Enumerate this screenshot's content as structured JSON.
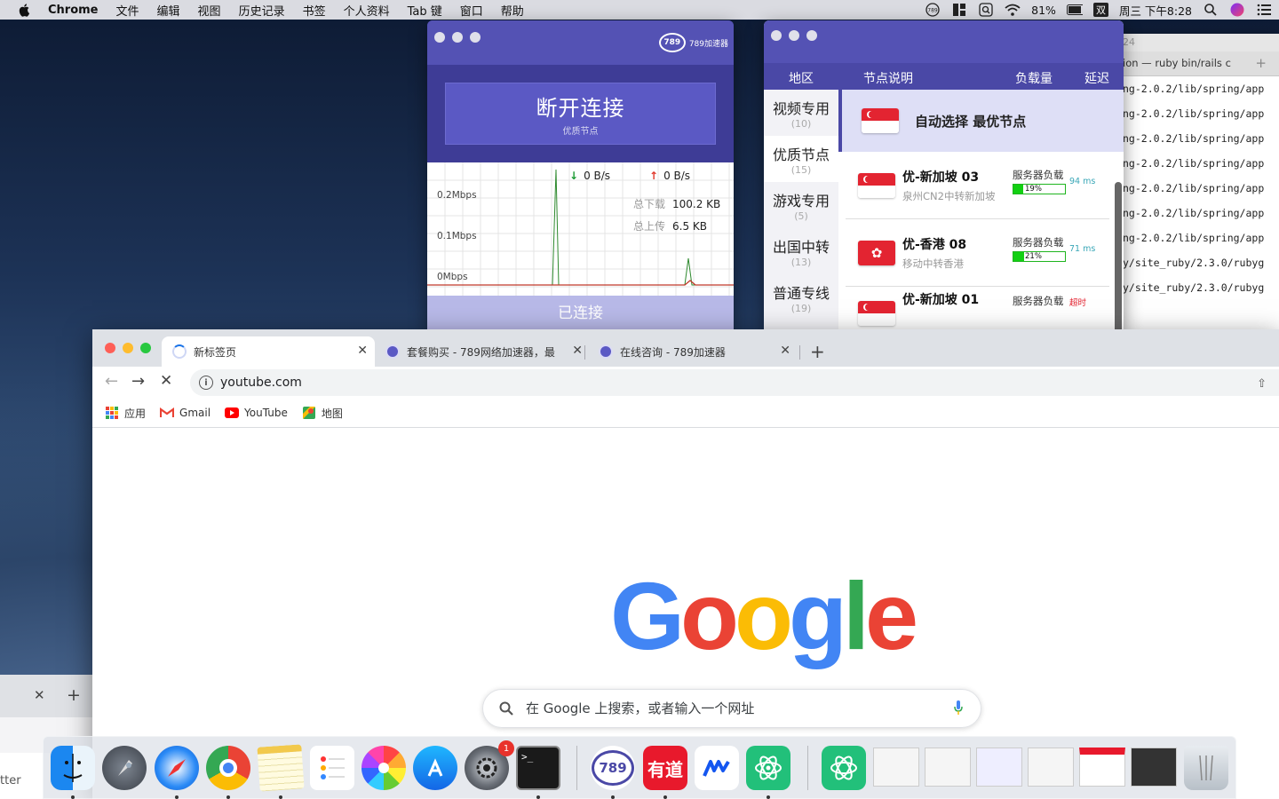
{
  "menubar": {
    "app_name": "Chrome",
    "items": [
      "文件",
      "编辑",
      "视图",
      "历史记录",
      "书签",
      "个人资料",
      "Tab 键",
      "窗口",
      "帮助"
    ],
    "battery": "81%",
    "input_method": "双",
    "clock": "周三 下午8:28"
  },
  "terminal": {
    "title_fragment": "24",
    "tab_title": "ion — ruby bin/rails c",
    "lines": [
      "ng-2.0.2/lib/spring/app",
      "ng-2.0.2/lib/spring/app",
      "ng-2.0.2/lib/spring/app",
      "ng-2.0.2/lib/spring/app",
      "ng-2.0.2/lib/spring/app",
      "ng-2.0.2/lib/spring/app",
      "ng-2.0.2/lib/spring/app",
      "y/site_ruby/2.3.0/rubyg",
      "y/site_ruby/2.3.0/rubyg"
    ]
  },
  "accel_main": {
    "brand_logo": "789",
    "brand_name": "789加速器",
    "disconnect_label": "断开连接",
    "disconnect_sub": "优质节点",
    "download_speed": "0 B/s",
    "upload_speed": "0 B/s",
    "axis": [
      "0.2Mbps",
      "0.1Mbps",
      "0Mbps"
    ],
    "total_download_label": "总下载",
    "total_download": "100.2 KB",
    "total_upload_label": "总上传",
    "total_upload": "6.5 KB",
    "status": "已连接"
  },
  "accel_nodes": {
    "header": {
      "region": "地区",
      "desc": "节点说明",
      "load": "负载量",
      "latency": "延迟"
    },
    "categories": [
      {
        "name": "视频专用",
        "count": "(10)"
      },
      {
        "name": "优质节点",
        "count": "(15)"
      },
      {
        "name": "游戏专用",
        "count": "(5)"
      },
      {
        "name": "出国中转",
        "count": "(13)"
      },
      {
        "name": "普通专线",
        "count": "(19)"
      }
    ],
    "auto_label": "自动选择 最优节点",
    "nodes": [
      {
        "name": "优-新加坡 03",
        "desc": "泉州CN2中转新加坡",
        "load_label": "服务器负载",
        "load_pct": "19%",
        "load_value": 0.19,
        "latency": "94 ms"
      },
      {
        "name": "优-香港 08",
        "desc": "移动中转香港",
        "load_label": "服务器负载",
        "load_pct": "21%",
        "load_value": 0.21,
        "latency": "71 ms"
      },
      {
        "name": "优-新加坡 01",
        "desc": "",
        "load_label": "服务器负载",
        "load_pct": "",
        "load_value": 0,
        "latency": "超时"
      }
    ]
  },
  "chrome": {
    "tabs": [
      {
        "title": "新标签页"
      },
      {
        "title": "套餐购买 - 789网络加速器，最"
      },
      {
        "title": "在线咨询 - 789加速器"
      }
    ],
    "url": "youtube.com",
    "bookmarks": [
      "应用",
      "Gmail",
      "YouTube",
      "地图"
    ],
    "google_letters": [
      "G",
      "o",
      "o",
      "g",
      "l",
      "e"
    ],
    "search_placeholder": "在 Google 上搜索，或者输入一个网址"
  },
  "left_partial": {
    "text": "tter"
  },
  "dock": {
    "settings_badge": "1",
    "youdao_label": "有道",
    "logo_789": "789",
    "terminal_prompt": ">_"
  },
  "colors": {
    "accent_purple": "#4a48a6",
    "google_blue": "#4285f4",
    "google_red": "#ea4335",
    "google_yellow": "#fbbc05",
    "google_green": "#34a853"
  }
}
